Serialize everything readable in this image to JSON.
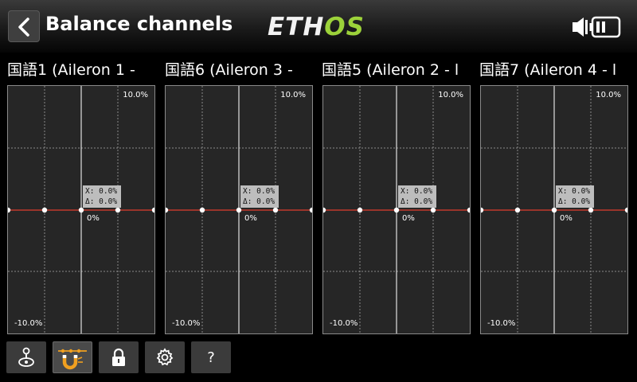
{
  "header": {
    "title": "Balance channels",
    "logo_part1": "ETH",
    "logo_part2": "OS"
  },
  "channels": [
    {
      "label": "国語1 (Aileron 1 -",
      "top_value": "10.0%",
      "bottom_value": "-10.0%",
      "tooltip_x": "X: 0.0%",
      "tooltip_delta": "Δ: 0.0%",
      "center_value": "0%"
    },
    {
      "label": "国語6 (Aileron 3 -",
      "top_value": "10.0%",
      "bottom_value": "-10.0%",
      "tooltip_x": "X: 0.0%",
      "tooltip_delta": "Δ: 0.0%",
      "center_value": "0%"
    },
    {
      "label": "国語5 (Aileron 2 - l",
      "top_value": "10.0%",
      "bottom_value": "-10.0%",
      "tooltip_x": "X: 0.0%",
      "tooltip_delta": "Δ: 0.0%",
      "center_value": "0%"
    },
    {
      "label": "国語7 (Aileron 4 - l",
      "top_value": "10.0%",
      "bottom_value": "-10.0%",
      "tooltip_x": "X: 0.0%",
      "tooltip_delta": "Δ: 0.0%",
      "center_value": "0%"
    }
  ],
  "toolbar": {
    "buttons": [
      "stick-icon",
      "magnet-curve-icon",
      "lock-icon",
      "gear-icon",
      "help-icon"
    ],
    "help_label": "?"
  },
  "colors": {
    "accent_green": "#9cd23a",
    "curve_red": "#c0392b",
    "magnet_orange": "#f0a020"
  }
}
